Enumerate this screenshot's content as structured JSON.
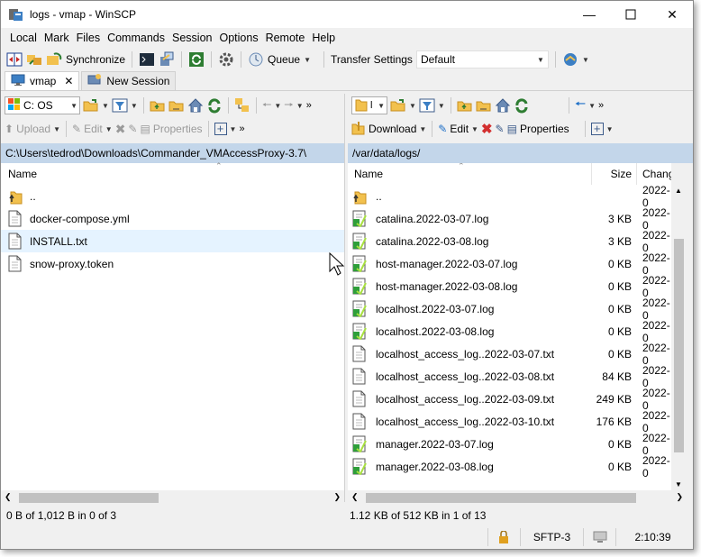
{
  "window": {
    "title": "logs - vmap - WinSCP"
  },
  "menu": [
    "Local",
    "Mark",
    "Files",
    "Commands",
    "Session",
    "Options",
    "Remote",
    "Help"
  ],
  "toolbar": {
    "synchronize": "Synchronize",
    "queue": "Queue",
    "transfer_settings_label": "Transfer Settings",
    "transfer_settings_value": "Default"
  },
  "tabs": {
    "session": "vmap",
    "new_session": "New Session"
  },
  "left": {
    "drive": "C: OS",
    "upload": "Upload",
    "edit": "Edit",
    "properties": "Properties",
    "path": "C:\\Users\\tedrod\\Downloads\\Commander_VMAccessProxy-3.7\\",
    "col_name": "Name",
    "files": [
      {
        "name": "..",
        "type": "up"
      },
      {
        "name": "docker-compose.yml",
        "type": "file"
      },
      {
        "name": "INSTALL.txt",
        "type": "file"
      },
      {
        "name": "snow-proxy.token",
        "type": "file"
      }
    ],
    "status": "0 B of 1,012 B in 0 of 3"
  },
  "right": {
    "download": "Download",
    "edit": "Edit",
    "properties": "Properties",
    "path": "/var/data/logs/",
    "col_name": "Name",
    "col_size": "Size",
    "col_changed": "Chang",
    "files": [
      {
        "name": "..",
        "size": "",
        "changed": "2022-0",
        "type": "up"
      },
      {
        "name": "catalina.2022-03-07.log",
        "size": "3 KB",
        "changed": "2022-0",
        "type": "log"
      },
      {
        "name": "catalina.2022-03-08.log",
        "size": "3 KB",
        "changed": "2022-0",
        "type": "log"
      },
      {
        "name": "host-manager.2022-03-07.log",
        "size": "0 KB",
        "changed": "2022-0",
        "type": "log"
      },
      {
        "name": "host-manager.2022-03-08.log",
        "size": "0 KB",
        "changed": "2022-0",
        "type": "log"
      },
      {
        "name": "localhost.2022-03-07.log",
        "size": "0 KB",
        "changed": "2022-0",
        "type": "log"
      },
      {
        "name": "localhost.2022-03-08.log",
        "size": "0 KB",
        "changed": "2022-0",
        "type": "log"
      },
      {
        "name": "localhost_access_log..2022-03-07.txt",
        "size": "0 KB",
        "changed": "2022-0",
        "type": "file"
      },
      {
        "name": "localhost_access_log..2022-03-08.txt",
        "size": "84 KB",
        "changed": "2022-0",
        "type": "file"
      },
      {
        "name": "localhost_access_log..2022-03-09.txt",
        "size": "249 KB",
        "changed": "2022-0",
        "type": "file"
      },
      {
        "name": "localhost_access_log..2022-03-10.txt",
        "size": "176 KB",
        "changed": "2022-0",
        "type": "file"
      },
      {
        "name": "manager.2022-03-07.log",
        "size": "0 KB",
        "changed": "2022-0",
        "type": "log"
      },
      {
        "name": "manager.2022-03-08.log",
        "size": "0 KB",
        "changed": "2022-0",
        "type": "log"
      }
    ],
    "status": "1.12 KB of 512 KB in 1 of 13"
  },
  "status": {
    "protocol": "SFTP-3",
    "time": "2:10:39"
  },
  "colors": {
    "path_bar": "#c3d6ea",
    "selection": "#e5f3ff",
    "accent": "#1e6fc7"
  }
}
